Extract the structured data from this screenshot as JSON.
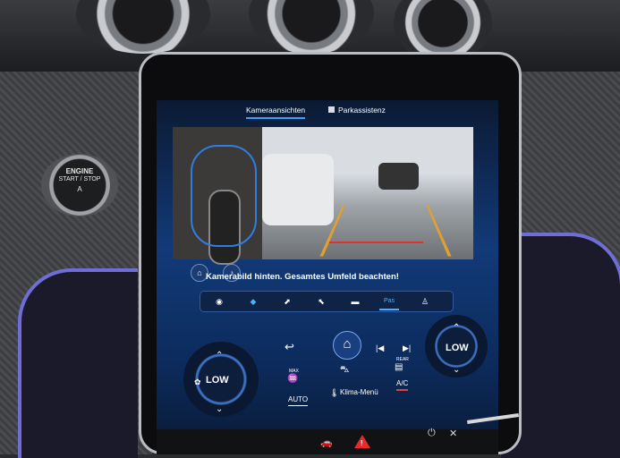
{
  "engine_button": {
    "line1": "ENGINE",
    "line2": "START / STOP",
    "icon": "A"
  },
  "tabs": [
    {
      "label": "Kameraansichten",
      "active": true
    },
    {
      "label": "Parkassistenz",
      "active": false
    }
  ],
  "camera_message": "Kamerabild hinten. Gesamtes Umfeld beachten!",
  "camera_modes": [
    {
      "icon": "front-camera-icon",
      "glyph": "◉"
    },
    {
      "icon": "top-view-icon",
      "glyph": "◆"
    },
    {
      "icon": "left-side-icon",
      "glyph": "⬈"
    },
    {
      "icon": "right-side-icon",
      "glyph": "⬉"
    },
    {
      "icon": "rear-wide-icon",
      "glyph": "▬"
    },
    {
      "icon": "rear-camera-icon",
      "label": "Pas",
      "selected": true
    },
    {
      "icon": "trailer-icon",
      "glyph": "♙"
    }
  ],
  "climate": {
    "left_temp": "LOW",
    "right_temp": "LOW",
    "max_defrost": "MAX",
    "rear_defrost": "REAR",
    "auto": "AUTO",
    "menu": "Klima-Menü",
    "ac": "A/C"
  },
  "colors": {
    "accent": "#3aa0ff",
    "ac_underline": "#e04040",
    "hazard": "#e52b2b"
  }
}
